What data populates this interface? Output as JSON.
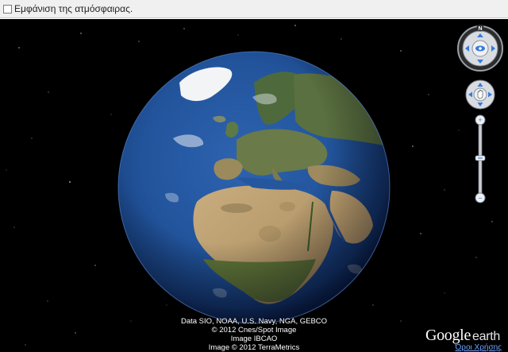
{
  "top_bar": {
    "atmosphere_label": "Εμφάνιση της ατμόσφαιρας."
  },
  "attribution": {
    "lines": [
      "Data SIO, NOAA, U.S. Navy, NGA, GEBCO",
      "© 2012 Cnes/Spot Image",
      "Image IBCAO",
      "Image © 2012 TerraMetrics"
    ]
  },
  "logo": {
    "google": "Google",
    "earth": "earth"
  },
  "terms_link": "Όροι Χρήσης",
  "navigation": {
    "compass_letter": "N"
  }
}
